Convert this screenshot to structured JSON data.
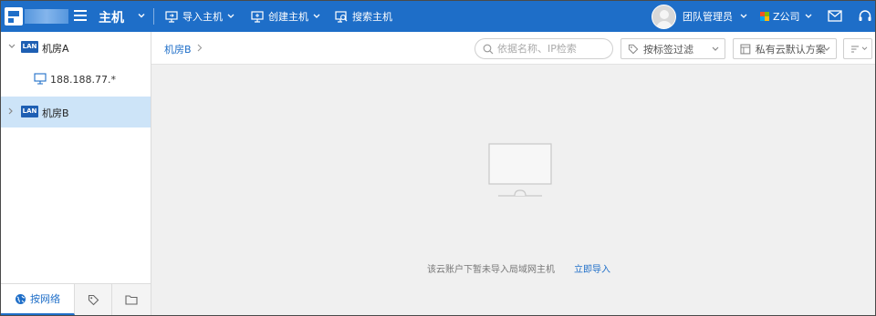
{
  "topbar": {
    "title": "主机",
    "actions": [
      {
        "label": "导入主机",
        "icon": "import-host-icon"
      },
      {
        "label": "创建主机",
        "icon": "create-host-icon"
      },
      {
        "label": "搜索主机",
        "icon": "search-host-icon"
      }
    ],
    "user": {
      "name": "团队管理员"
    },
    "company": {
      "name": "Z公司"
    },
    "icons": [
      "mail-icon",
      "headset-icon"
    ]
  },
  "sidebar": {
    "tree": [
      {
        "badge": "LAN",
        "label": "机房A",
        "expanded": true,
        "selected": false,
        "children": [
          {
            "label": "188.188.77.*",
            "icon": "monitor-icon"
          }
        ]
      },
      {
        "badge": "LAN",
        "label": "机房B",
        "expanded": false,
        "selected": true
      }
    ],
    "tabs": [
      {
        "label": "按网络",
        "icon": "globe-icon",
        "active": true
      },
      {
        "label": "",
        "icon": "tag-icon",
        "active": false
      },
      {
        "label": "",
        "icon": "folder-icon",
        "active": false
      }
    ]
  },
  "main": {
    "breadcrumb": "机房B",
    "search_placeholder": "依据名称、IP检索",
    "tag_filter": "按标签过滤",
    "plan_select": "私有云默认方案",
    "empty_message": "该云账户下暂未导入局域网主机",
    "empty_action": "立即导入"
  },
  "colors": {
    "topbar_bg": "#1e6ec8",
    "selected_row": "#cde4f8",
    "link": "#1e6ec8",
    "lan_badge": "#1e5fb3",
    "main_bg": "#f0f0f0"
  }
}
